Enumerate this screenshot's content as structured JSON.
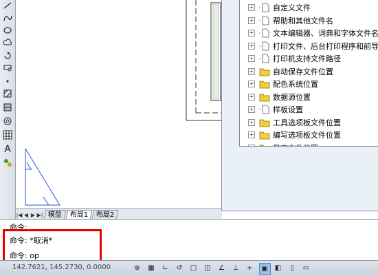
{
  "left_toolbar": {
    "icons": [
      "line-icon",
      "arc-icon",
      "ellipse-icon",
      "revision-cloud-icon",
      "rotate-icon",
      "circle-icon",
      "point-icon",
      "hatch-icon",
      "gradient-icon",
      "region-icon",
      "table-icon",
      "text-icon",
      "add-selected-icon"
    ],
    "text_tool_glyph": "A"
  },
  "layout_tabs": {
    "nav": [
      "|◀",
      "◀",
      "▶",
      "▶|"
    ],
    "tabs": [
      {
        "label": "模型"
      },
      {
        "label": "布局1"
      },
      {
        "label": "布局2"
      }
    ],
    "active_index": 1
  },
  "options_tree": [
    {
      "label": "自定义文件",
      "icon": "document-icon"
    },
    {
      "label": "帮助和其他文件名",
      "icon": "document-icon"
    },
    {
      "label": "文本编辑器、词典和字体文件名",
      "icon": "document-icon"
    },
    {
      "label": "打印文件、后台打印程序和前导",
      "icon": "document-icon"
    },
    {
      "label": "打印机支持文件路径",
      "icon": "document-icon"
    },
    {
      "label": "自动保存文件位置",
      "icon": "folder-icon"
    },
    {
      "label": "配色系统位置",
      "icon": "folder-icon"
    },
    {
      "label": "数据源位置",
      "icon": "folder-icon"
    },
    {
      "label": "样板设置",
      "icon": "document-icon"
    },
    {
      "label": "工具选项板文件位置",
      "icon": "folder-icon"
    },
    {
      "label": "编写选项板文件位置",
      "icon": "folder-icon"
    },
    {
      "label": "日志文件位置",
      "icon": "folder-icon"
    }
  ],
  "command_lines": [
    "命令:",
    "命令: *取消*",
    "命令: op"
  ],
  "status_bar": {
    "coordinates": "142.7621,  145.2730, 0.0000",
    "buttons": [
      "snap-icon",
      "grid-icon",
      "ortho-icon",
      "polar-icon",
      "osnap-icon",
      "3d-osnap-icon",
      "otrack-icon",
      "ducs-icon",
      "dyn-icon",
      "lineweight-icon",
      "transparency-icon",
      "quick-properties-icon",
      "selection-cycling-icon"
    ]
  },
  "colors": {
    "highlight": "#e00000",
    "drawing_blue": "#2a56d8",
    "folder_yellow": "#f3cf3a"
  }
}
